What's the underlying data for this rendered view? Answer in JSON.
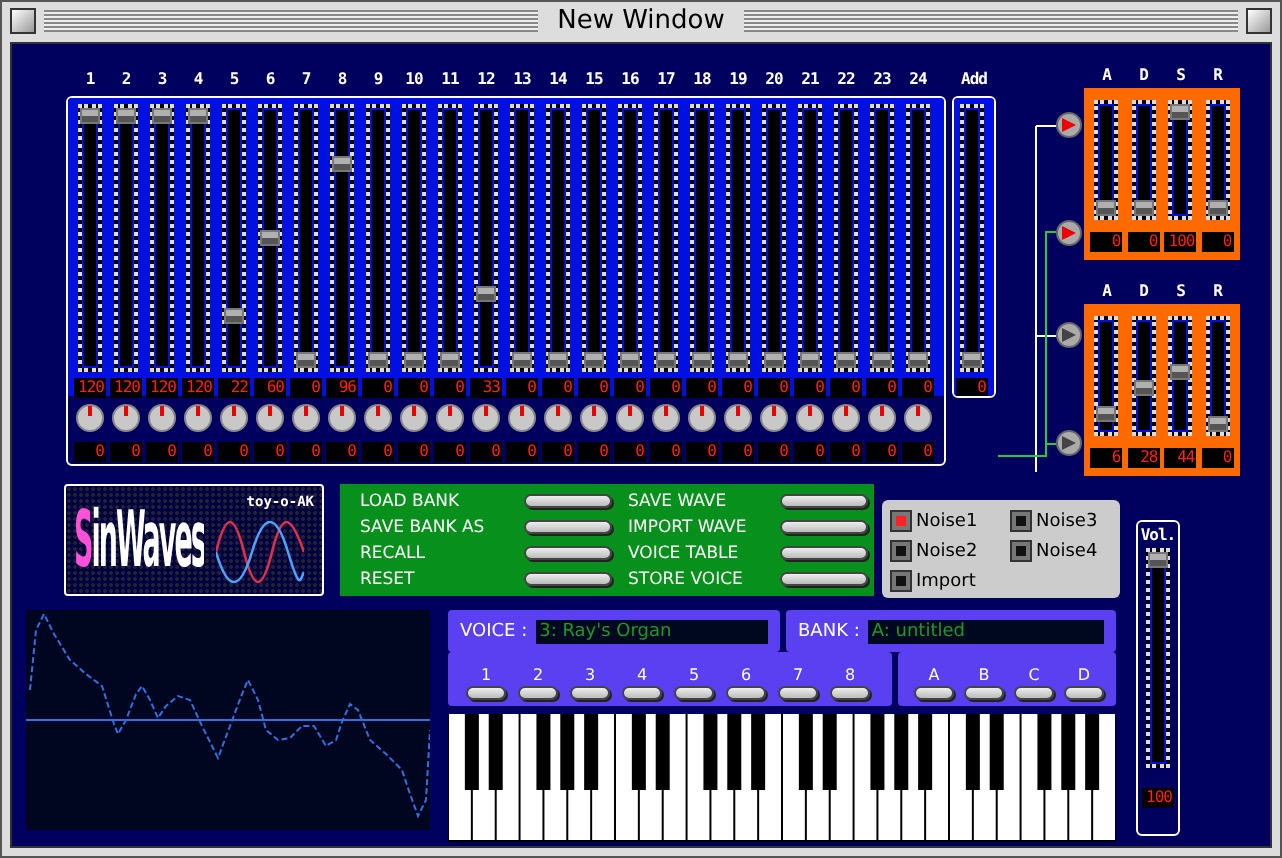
{
  "window": {
    "title": "New Window"
  },
  "partials": [
    {
      "label": "1",
      "level": 1,
      "value": "120",
      "knob_value": "0"
    },
    {
      "label": "2",
      "level": 1,
      "value": "120",
      "knob_value": "0"
    },
    {
      "label": "3",
      "level": 1,
      "value": "120",
      "knob_value": "0"
    },
    {
      "label": "4",
      "level": 1,
      "value": "120",
      "knob_value": "0"
    },
    {
      "label": "5",
      "level": 0.18,
      "value": "22",
      "knob_value": "0"
    },
    {
      "label": "6",
      "level": 0.5,
      "value": "60",
      "knob_value": "0"
    },
    {
      "label": "7",
      "level": 0,
      "value": "0",
      "knob_value": "0"
    },
    {
      "label": "8",
      "level": 0.8,
      "value": "96",
      "knob_value": "0"
    },
    {
      "label": "9",
      "level": 0,
      "value": "0",
      "knob_value": "0"
    },
    {
      "label": "10",
      "level": 0,
      "value": "0",
      "knob_value": "0"
    },
    {
      "label": "11",
      "level": 0,
      "value": "0",
      "knob_value": "0"
    },
    {
      "label": "12",
      "level": 0.27,
      "value": "33",
      "knob_value": "0"
    },
    {
      "label": "13",
      "level": 0,
      "value": "0",
      "knob_value": "0"
    },
    {
      "label": "14",
      "level": 0,
      "value": "0",
      "knob_value": "0"
    },
    {
      "label": "15",
      "level": 0,
      "value": "0",
      "knob_value": "0"
    },
    {
      "label": "16",
      "level": 0,
      "value": "0",
      "knob_value": "0"
    },
    {
      "label": "17",
      "level": 0,
      "value": "0",
      "knob_value": "0"
    },
    {
      "label": "18",
      "level": 0,
      "value": "0",
      "knob_value": "0"
    },
    {
      "label": "19",
      "level": 0,
      "value": "0",
      "knob_value": "0"
    },
    {
      "label": "20",
      "level": 0,
      "value": "0",
      "knob_value": "0"
    },
    {
      "label": "21",
      "level": 0,
      "value": "0",
      "knob_value": "0"
    },
    {
      "label": "22",
      "level": 0,
      "value": "0",
      "knob_value": "0"
    },
    {
      "label": "23",
      "level": 0,
      "value": "0",
      "knob_value": "0"
    },
    {
      "label": "24",
      "level": 0,
      "value": "0",
      "knob_value": "0"
    }
  ],
  "add": {
    "label": "Add",
    "level": 0,
    "value": "0"
  },
  "routes": [
    {
      "on": true
    },
    {
      "on": true
    },
    {
      "on": false
    },
    {
      "on": false
    }
  ],
  "envelopes": [
    {
      "sliders": [
        {
          "label": "A",
          "level": 0,
          "value": "0"
        },
        {
          "label": "D",
          "level": 0,
          "value": "0"
        },
        {
          "label": "S",
          "level": 1,
          "value": "100"
        },
        {
          "label": "R",
          "level": 0,
          "value": "0"
        }
      ]
    },
    {
      "sliders": [
        {
          "label": "A",
          "level": 0.1,
          "value": "6"
        },
        {
          "label": "D",
          "level": 0.38,
          "value": "28"
        },
        {
          "label": "S",
          "level": 0.55,
          "value": "44"
        },
        {
          "label": "R",
          "level": 0,
          "value": "0"
        }
      ]
    }
  ],
  "logo": {
    "title": "SinWaves",
    "subtitle": "toy-o-AK"
  },
  "actions": [
    {
      "label": "LOAD BANK"
    },
    {
      "label": "SAVE BANK AS"
    },
    {
      "label": "RECALL"
    },
    {
      "label": "RESET"
    },
    {
      "label": "SAVE WAVE"
    },
    {
      "label": "IMPORT WAVE"
    },
    {
      "label": "VOICE TABLE"
    },
    {
      "label": "STORE VOICE"
    }
  ],
  "noise": [
    {
      "label": "Noise1",
      "checked": true
    },
    {
      "label": "Noise3",
      "checked": false
    },
    {
      "label": "Noise2",
      "checked": false
    },
    {
      "label": "Noise4",
      "checked": false
    },
    {
      "label": "Import",
      "checked": false
    }
  ],
  "volume": {
    "label": "Vol.",
    "level": 1,
    "value": "100"
  },
  "voice": {
    "label": "VOICE :",
    "value": "3: Ray's Organ",
    "buttons": [
      "1",
      "2",
      "3",
      "4",
      "5",
      "6",
      "7",
      "8"
    ]
  },
  "bank": {
    "label": "BANK :",
    "value": "A: untitled",
    "buttons": [
      "A",
      "B",
      "C",
      "D"
    ]
  }
}
